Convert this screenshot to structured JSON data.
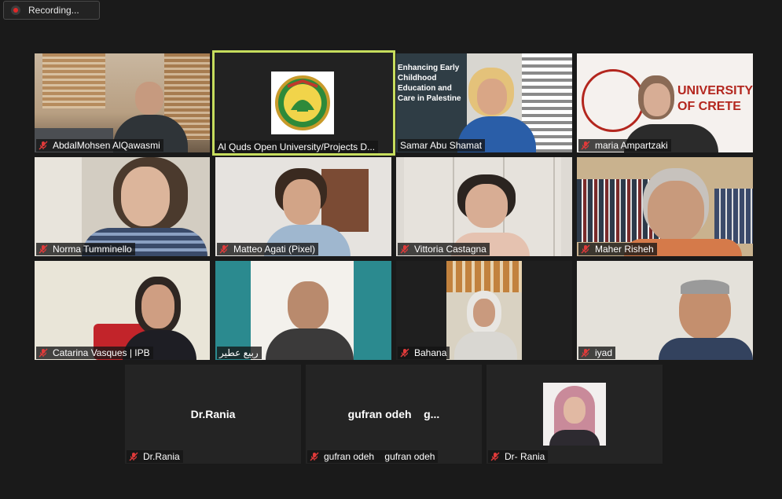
{
  "recording": {
    "label": "Recording..."
  },
  "tiles": [
    {
      "name": "AbdalMohsen AlQawasmi"
    },
    {
      "name": "Al Quds Open University/Projects D..."
    },
    {
      "name": "Samar Abu Shamat",
      "banner": "Enhancing Early Childhood Education and Care in Palestine"
    },
    {
      "name": "maria Ampartzaki",
      "banner": "UNIVERSITY OF CRETE"
    },
    {
      "name": "Norma Tumminello"
    },
    {
      "name": "Matteo Agati (Pixel)"
    },
    {
      "name": "Vittoria Castagna"
    },
    {
      "name": "Maher Risheh"
    },
    {
      "name": "Catarina Vasques | IPB"
    },
    {
      "name": "ربيع عطير"
    },
    {
      "name": "Bahana"
    },
    {
      "name": "iyad"
    },
    {
      "name": "Dr.Rania",
      "display": "Dr.Rania"
    },
    {
      "name": "gufran odeh    gufran odeh",
      "display": "gufran odeh    g..."
    },
    {
      "name": "Dr- Rania"
    }
  ],
  "colors": {
    "active_border": "#c6dd5d",
    "muted_mic": "#e03a3a",
    "background": "#1a1a1a"
  },
  "icons": {
    "muted": "mic-muted-icon",
    "recording": "record-dot-icon"
  }
}
